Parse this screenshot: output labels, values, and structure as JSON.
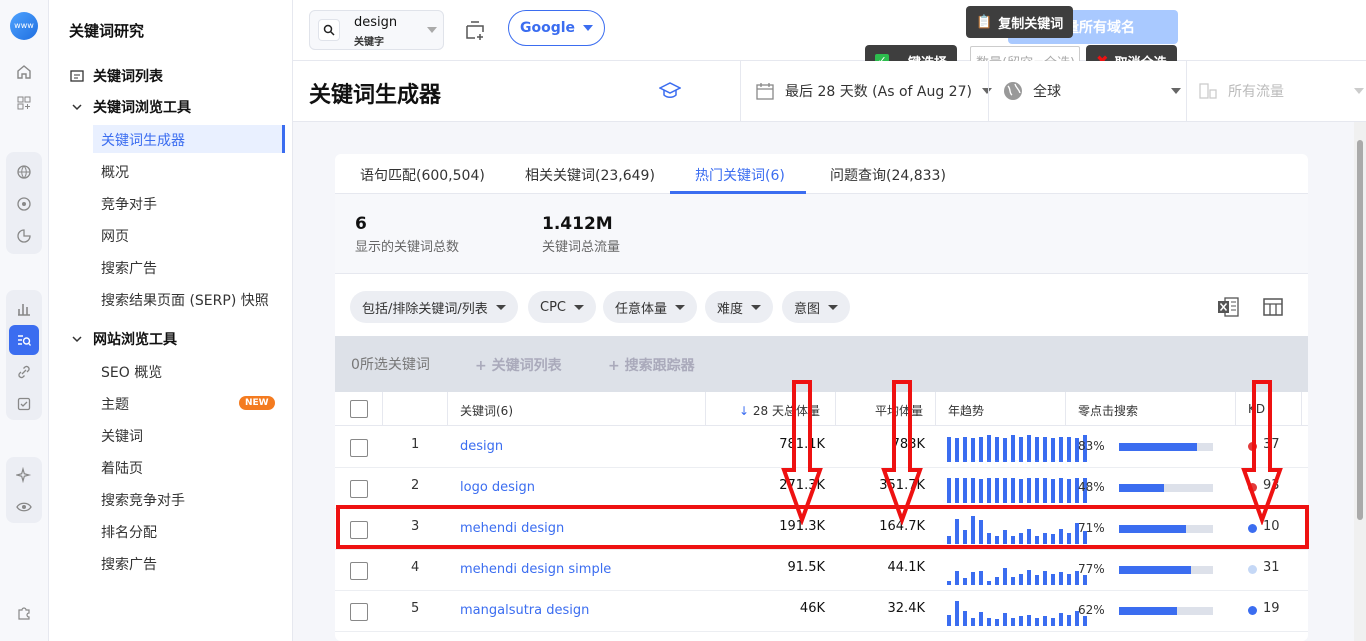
{
  "sidebar": {
    "title": "关键词研究",
    "sections": [
      {
        "label": "关键词列表"
      },
      {
        "label": "关键词浏览工具"
      },
      {
        "label": "网站浏览工具"
      }
    ],
    "kw_tools": [
      "关键词生成器",
      "概况",
      "竞争对手",
      "网页",
      "搜索广告",
      "搜索结果页面 (SERP) 快照"
    ],
    "site_tools": [
      "SEO 概览",
      "主题",
      "关键词",
      "着陆页",
      "搜索竞争对手",
      "排名分配",
      "搜索广告"
    ],
    "new_badge": "NEW"
  },
  "topbar": {
    "search_value": "design",
    "search_sub": "关键字",
    "engine": "Google",
    "faded_button": "流量所有域名",
    "copy_keywords": "复制关键词",
    "select_all": "一键选择",
    "count_placeholder": "数量(留空=全选)",
    "cancel_all": "取消全选"
  },
  "header": {
    "title": "关键词生成器",
    "date_range": "最后 28 天数 (As of Aug 27)",
    "region": "全球",
    "traffic": "所有流量"
  },
  "tabs": [
    {
      "label": "语句匹配(600,504)"
    },
    {
      "label": "相关关键词(23,649)"
    },
    {
      "label": "热门关键词(6)"
    },
    {
      "label": "问题查询(24,833)"
    }
  ],
  "stats": {
    "count_value": "6",
    "count_label": "显示的关键词总数",
    "traffic_value": "1.412M",
    "traffic_label": "关键词总流量"
  },
  "filters": [
    "包括/排除关键词/列表",
    "CPC",
    "任意体量",
    "难度",
    "意图"
  ],
  "actionbar": {
    "selected": "0所选关键词",
    "add_list": "关键词列表",
    "add_tracker": "搜索跟踪器"
  },
  "table": {
    "headers": {
      "keyword": "关键词(6)",
      "volume28": "28 天总体量",
      "avg_volume": "平均体量",
      "trend": "年趋势",
      "zero_click": "零点击搜索",
      "kd": "KD"
    },
    "rows": [
      {
        "num": "1",
        "keyword": "design",
        "volume28": "781.1K",
        "avg": "783K",
        "zero_pct": "83%",
        "zero_frac": 0.83,
        "kd": "37",
        "kd_color": "#e23b3b",
        "trend": [
          0.9,
          0.85,
          0.9,
          0.85,
          0.9,
          0.95,
          0.9,
          0.85,
          0.95,
          0.9,
          0.95,
          0.9,
          0.9,
          0.85,
          0.9,
          0.9,
          0.85,
          0.95
        ]
      },
      {
        "num": "2",
        "keyword": "logo design",
        "volume28": "271.3K",
        "avg": "351.7K",
        "zero_pct": "48%",
        "zero_frac": 0.48,
        "kd": "93",
        "kd_color": "#e23b3b",
        "trend": [
          0.9,
          0.9,
          0.9,
          0.9,
          0.85,
          0.9,
          0.9,
          0.9,
          0.9,
          0.85,
          0.9,
          0.9,
          0.9,
          0.85,
          0.9,
          0.85,
          0.9,
          0.9
        ]
      },
      {
        "num": "3",
        "keyword": "mehendi design",
        "volume28": "191.3K",
        "avg": "164.7K",
        "zero_pct": "71%",
        "zero_frac": 0.71,
        "kd": "10",
        "kd_color": "#3b6df0",
        "trend": [
          0.3,
          0.9,
          0.5,
          1.0,
          0.85,
          0.4,
          0.3,
          0.5,
          0.3,
          0.4,
          0.55,
          0.3,
          0.4,
          0.35,
          0.55,
          0.4,
          0.75,
          0.45
        ]
      },
      {
        "num": "4",
        "keyword": "mehendi design simple",
        "volume28": "91.5K",
        "avg": "44.1K",
        "zero_pct": "77%",
        "zero_frac": 0.77,
        "kd": "31",
        "kd_color": "#c5d8f6",
        "trend": [
          0.15,
          0.5,
          0.25,
          0.45,
          0.5,
          0.15,
          0.3,
          0.6,
          0.3,
          0.4,
          0.55,
          0.35,
          0.5,
          0.4,
          0.45,
          0.4,
          0.5,
          0.35
        ]
      },
      {
        "num": "5",
        "keyword": "mangalsutra design",
        "volume28": "46K",
        "avg": "32.4K",
        "zero_pct": "62%",
        "zero_frac": 0.62,
        "kd": "19",
        "kd_color": "#3b6df0",
        "trend": [
          0.4,
          0.9,
          0.55,
          0.3,
          0.5,
          0.3,
          0.25,
          0.45,
          0.3,
          0.35,
          0.4,
          0.3,
          0.35,
          0.3,
          0.45,
          0.4,
          0.55,
          0.35
        ]
      }
    ]
  },
  "colors": {
    "accent": "#3b6df0",
    "highlight": "#e11111",
    "new_badge": "#f47b20"
  }
}
